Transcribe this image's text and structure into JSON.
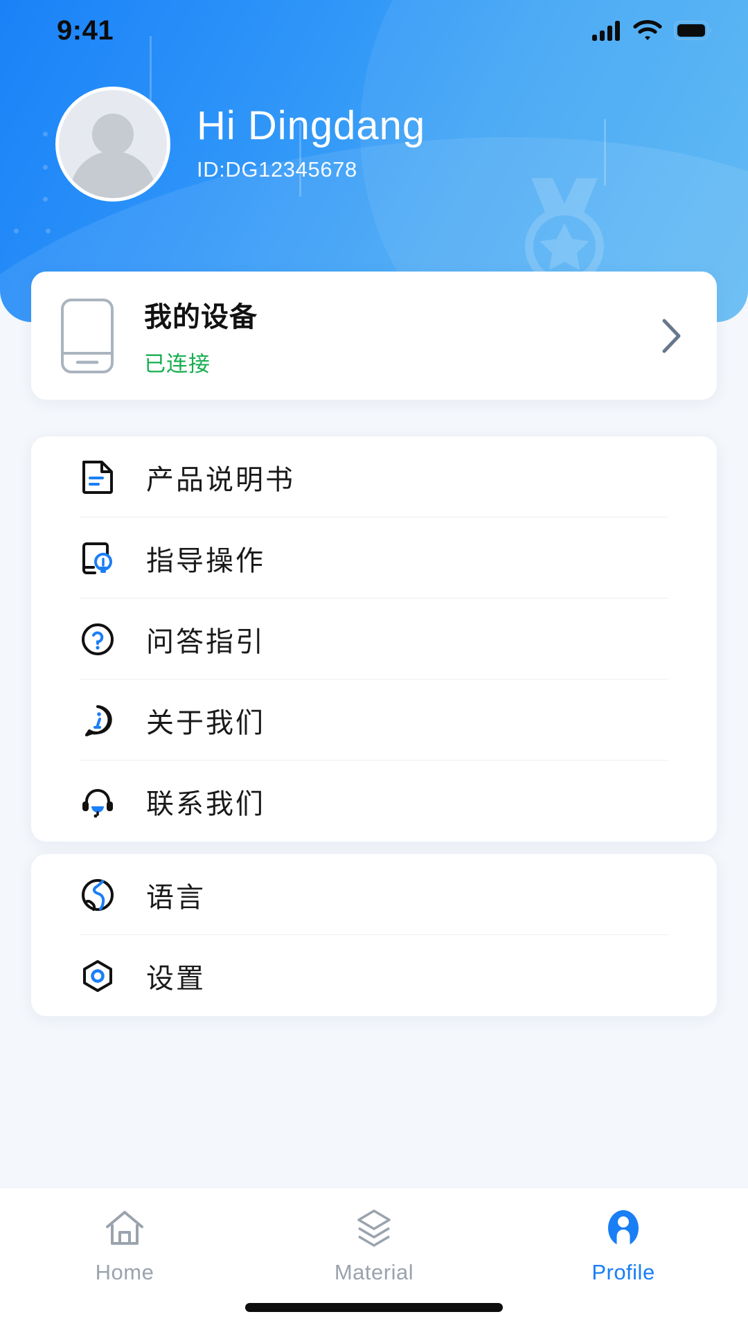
{
  "status_bar": {
    "time": "9:41",
    "icons": [
      "cellular-signal-icon",
      "wifi-icon",
      "battery-icon"
    ]
  },
  "header": {
    "greeting": "Hi Dingdang",
    "user_id": "ID:DG12345678",
    "avatar_icon": "default-avatar-icon",
    "gradient_from": "#1a82f7",
    "gradient_to": "#57b6f3"
  },
  "device_card": {
    "icon": "device-icon",
    "title": "我的设备",
    "status": "已连接",
    "status_color": "#17ae4f",
    "chevron_icon": "chevron-right-icon"
  },
  "menu_group_1": {
    "items": [
      {
        "label": "产品说明书",
        "icon": "document-icon"
      },
      {
        "label": "指导操作",
        "icon": "guide-lightbulb-icon"
      },
      {
        "label": "问答指引",
        "icon": "question-circle-icon"
      },
      {
        "label": "关于我们",
        "icon": "info-bubble-icon"
      },
      {
        "label": "联系我们",
        "icon": "headset-icon"
      }
    ]
  },
  "menu_group_2": {
    "items": [
      {
        "label": "语言",
        "icon": "globe-icon"
      },
      {
        "label": "设置",
        "icon": "settings-hexagon-icon"
      }
    ]
  },
  "tab_bar": {
    "active": "Profile",
    "accent_color": "#1a7ef5",
    "inactive_color": "#9aa3ad",
    "tabs": [
      {
        "label": "Home",
        "icon": "home-icon",
        "active": false
      },
      {
        "label": "Material",
        "icon": "layers-icon",
        "active": false
      },
      {
        "label": "Profile",
        "icon": "person-icon",
        "active": true
      }
    ]
  }
}
